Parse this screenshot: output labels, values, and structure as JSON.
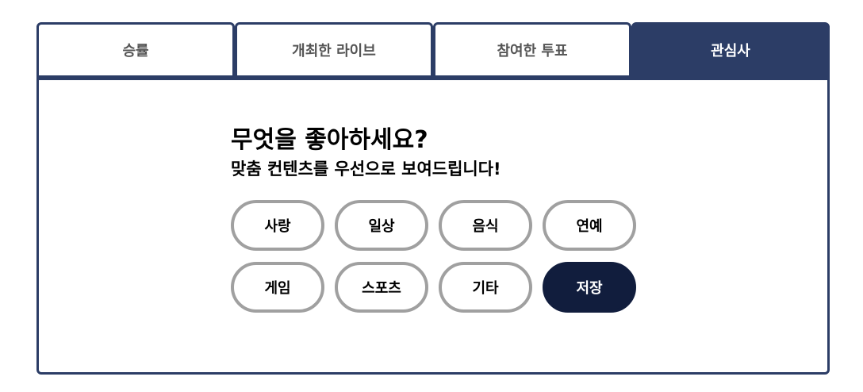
{
  "tabs": [
    {
      "label": "승률",
      "active": false
    },
    {
      "label": "개최한 라이브",
      "active": false
    },
    {
      "label": "참여한 투표",
      "active": false
    },
    {
      "label": "관심사",
      "active": true
    }
  ],
  "panel": {
    "heading": "무엇을 좋아하세요?",
    "subheading": "맞춤 컨텐츠를 우선으로 보여드립니다!",
    "interests": [
      "사랑",
      "일상",
      "음식",
      "연예",
      "게임",
      "스포츠",
      "기타"
    ],
    "save_label": "저장"
  },
  "colors": {
    "navy": "#2c3d66",
    "dark_navy": "#111d3d",
    "chip_border": "#a0a0a0"
  }
}
